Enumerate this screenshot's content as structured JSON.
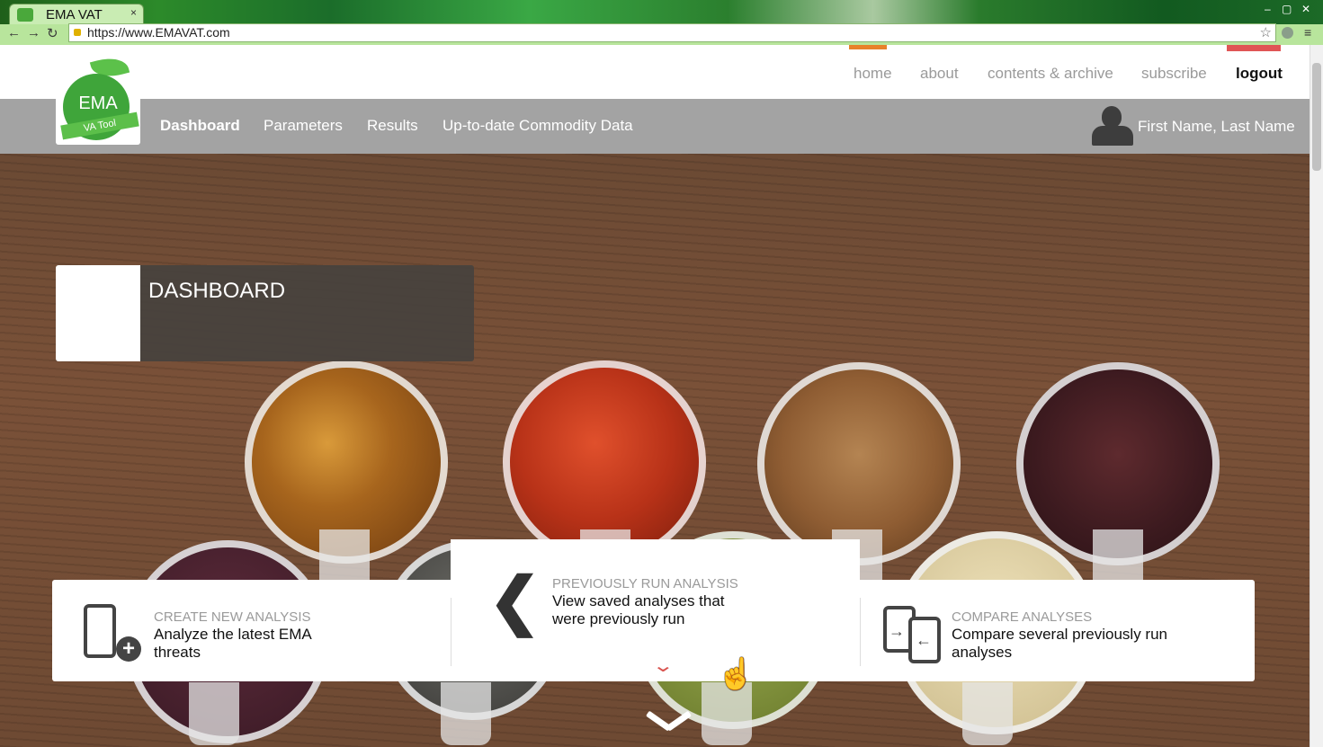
{
  "browser": {
    "tab_title": "EMA VAT",
    "tab_close": "×",
    "url": "https://www.EMAVAT.com",
    "back": "←",
    "forward": "→",
    "reload": "↻",
    "star": "☆",
    "menu": "≡",
    "win_min": "–",
    "win_max": "▢",
    "win_close": "✕"
  },
  "logo": {
    "main": "EMA",
    "ribbon": "VA Tool"
  },
  "top_nav": {
    "home": "home",
    "about": "about",
    "contents": "contents & archive",
    "subscribe": "subscribe",
    "logout": "logout"
  },
  "sub_nav": {
    "dashboard": "Dashboard",
    "parameters": "Parameters",
    "results": "Results",
    "commodity": "Up-to-date Commodity Data"
  },
  "user": {
    "name": "First Name, Last Name"
  },
  "banner": {
    "title": "DASHBOARD"
  },
  "cards": {
    "create": {
      "label": "CREATE NEW ANALYSIS",
      "desc": "Analyze the latest EMA threats"
    },
    "previous": {
      "label": "PREVIOUSLY RUN ANALYSIS",
      "desc": "View saved analyses that were previously run"
    },
    "compare": {
      "label": "COMPARE ANALYSES",
      "desc": "Compare several previously run analyses"
    }
  },
  "icons": {
    "chevron_left": "❮",
    "chevron_down": "⌄",
    "plus": "+",
    "arrow_right": "→",
    "arrow_left": "←",
    "cursor": "☝"
  },
  "colors": {
    "accent_orange": "#e8822a",
    "accent_red": "#e05555",
    "subnav_gray": "#a3a3a3",
    "chevron_red": "#d9534f"
  }
}
